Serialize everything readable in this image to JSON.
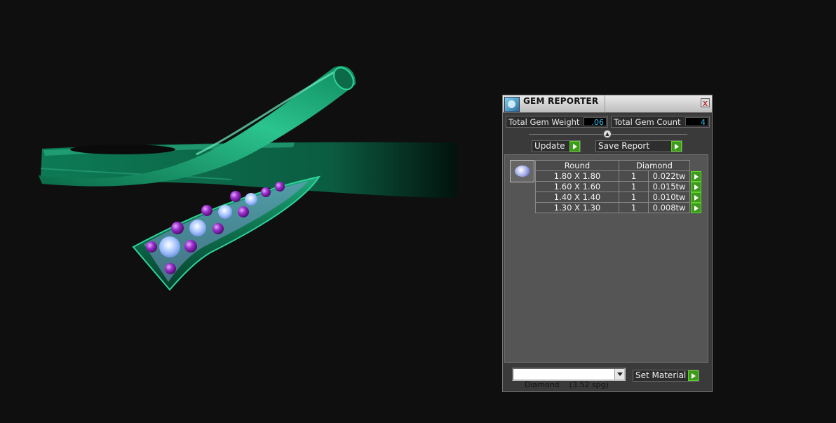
{
  "panel": {
    "title": "GEM REPORTER",
    "close_glyph": "x",
    "total_weight_label": "Total Gem Weight",
    "total_weight_value": ".06",
    "total_count_label": "Total Gem Count",
    "total_count_value": "4",
    "update_label": "Update",
    "save_report_label": "Save Report",
    "table": {
      "headers": [
        "Round",
        "Diamond"
      ],
      "rows": [
        {
          "size": "1.80 X 1.80",
          "qty": "1",
          "weight": "0.022tw"
        },
        {
          "size": "1.60 X 1.60",
          "qty": "1",
          "weight": "0.015tw"
        },
        {
          "size": "1.40 X 1.40",
          "qty": "1",
          "weight": "0.010tw"
        },
        {
          "size": "1.30 X 1.30",
          "qty": "1",
          "weight": "0.008tw"
        }
      ]
    },
    "material_select": "Diamond    (3.52 spg)",
    "set_material_label": "Set Material"
  },
  "colors": {
    "metal": "#0f8a5e",
    "gem_purple": "#8a1fb8",
    "gem_blue": "#8ab0f5",
    "accent_value": "#33bff2",
    "play_button": "#3e9a1c"
  },
  "icons": [
    "app-icon",
    "close-icon",
    "gem-thumbnail-icon",
    "play-arrow-icon",
    "dropdown-arrow-icon"
  ]
}
